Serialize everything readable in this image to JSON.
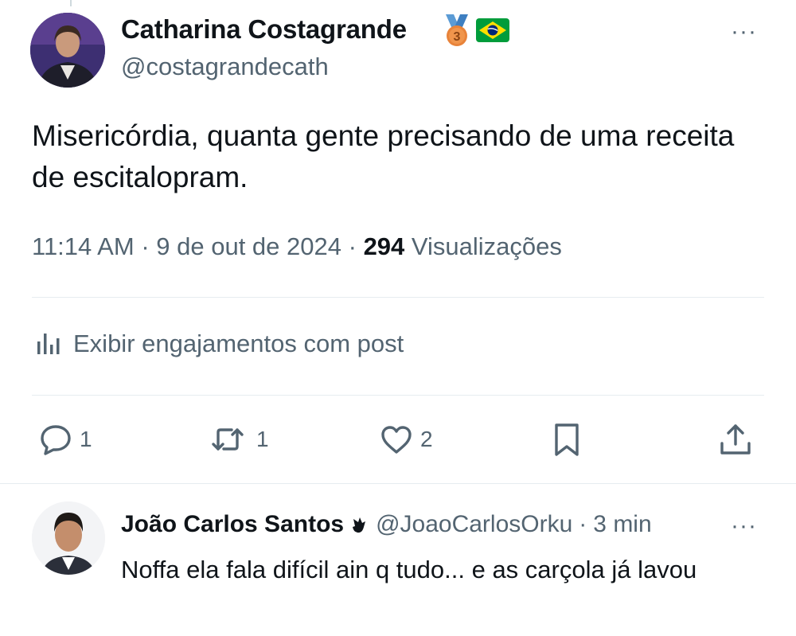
{
  "post": {
    "author_name": "Catharina Costagrande",
    "author_handle": "@costagrandecath",
    "medal_number": "3",
    "text": "Misericórdia, quanta gente precisando de uma receita de escitalopram.",
    "time": "11:14 AM",
    "date": "9 de out de 2024",
    "separator": "·",
    "views_count": "294",
    "views_label": "Visualizações",
    "engagements_label": "Exibir engajamentos com post",
    "more_icon": "···",
    "actions": {
      "reply_count": "1",
      "retweet_count": "1",
      "like_count": "2"
    }
  },
  "reply": {
    "author_name": "João Carlos Santos",
    "author_handle": "@JoaoCarlosOrku",
    "separator": "·",
    "time": "3 min",
    "text": "Noffa ela fala difícil ain q tudo... e as carçola já lavou",
    "more_icon": "···"
  },
  "colors": {
    "text_primary": "#0f1419",
    "text_secondary": "#536471",
    "divider": "#e6ecf0",
    "medal_orange": "#e8833a",
    "medal_ribbon": "#5b9bd5",
    "flag_green": "#009c3b",
    "flag_yellow": "#ffdf00",
    "flag_blue": "#002776"
  },
  "icons": {
    "engagements": "bar-chart-icon",
    "reply": "speech-bubble-icon",
    "retweet": "retweet-icon",
    "like": "heart-icon",
    "bookmark": "bookmark-icon",
    "share": "share-icon",
    "medal": "bronze-medal-icon",
    "flag": "brazil-flag-icon",
    "reply_badge": "hand-icon"
  }
}
